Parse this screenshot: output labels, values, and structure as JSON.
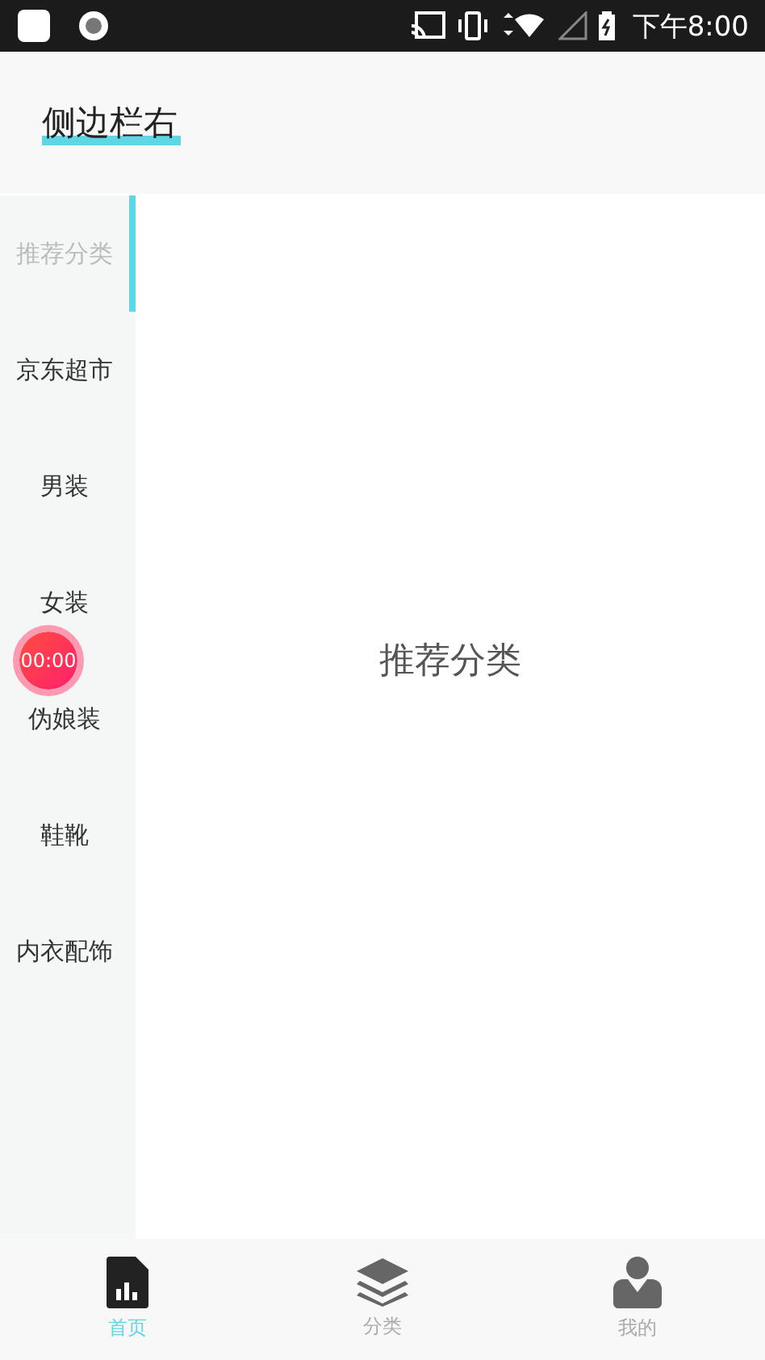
{
  "status_bar": {
    "time": "下午8:00"
  },
  "header": {
    "title": "侧边栏右"
  },
  "sidebar": {
    "items": [
      {
        "label": "推荐分类",
        "selected": true
      },
      {
        "label": "京东超市",
        "selected": false
      },
      {
        "label": "男装",
        "selected": false
      },
      {
        "label": "女装",
        "selected": false
      },
      {
        "label": "伪娘装",
        "selected": false
      },
      {
        "label": "鞋靴",
        "selected": false
      },
      {
        "label": "内衣配饰",
        "selected": false
      }
    ]
  },
  "content": {
    "title": "推荐分类"
  },
  "floating_timer": {
    "text": "00:00"
  },
  "tab_bar": [
    {
      "label": "首页",
      "kind": "home",
      "selected": true
    },
    {
      "label": "分类",
      "kind": "layers",
      "selected": false
    },
    {
      "label": "我的",
      "kind": "person",
      "selected": false
    }
  ]
}
